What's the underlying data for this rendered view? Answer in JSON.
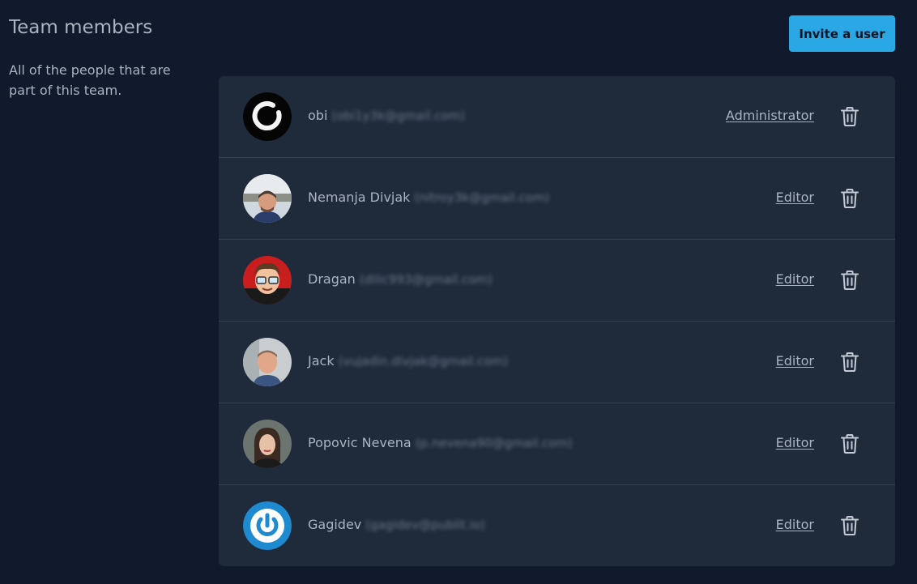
{
  "sidebar": {
    "title": "Team members",
    "description": "All of the people that are part of this team."
  },
  "invite_button": "Invite a user",
  "members": [
    {
      "name": "obi",
      "email": "(obi1y3k@gmail.com)",
      "role": "Administrator",
      "avatar": "enso-circle-avatar"
    },
    {
      "name": "Nemanja Divjak",
      "email": "(nitroy3k@gmail.com)",
      "role": "Editor",
      "avatar": "photo-avatar"
    },
    {
      "name": "Dragan",
      "email": "(dilic993@gmail.com)",
      "role": "Editor",
      "avatar": "cartoon-avatar"
    },
    {
      "name": "Jack",
      "email": "(vujadin.divjak@gmail.com)",
      "role": "Editor",
      "avatar": "photo-avatar"
    },
    {
      "name": "Popovic Nevena",
      "email": "(p.nevena90@gmail.com)",
      "role": "Editor",
      "avatar": "photo-avatar"
    },
    {
      "name": "Gagidev",
      "email": "(gagidev@publit.io)",
      "role": "Editor",
      "avatar": "power-logo-avatar"
    }
  ],
  "colors": {
    "background": "#101a2c",
    "card": "#1f2a3b",
    "accent": "#2aa8e6",
    "text": "#aab3c1"
  }
}
